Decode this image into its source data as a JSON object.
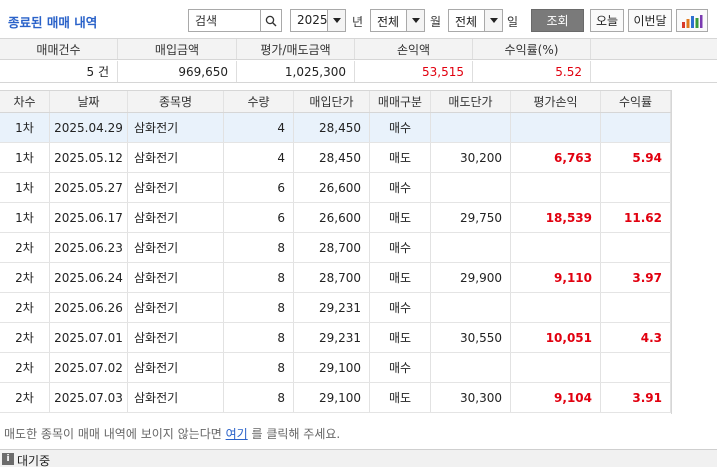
{
  "header": {
    "title": "종료된 매매 내역",
    "search": {
      "value": "검색",
      "placeholder": "검색"
    },
    "year": "2025",
    "year_suffix": "년",
    "month": "전체",
    "month_suffix": "월",
    "day": "전체",
    "day_suffix": "일",
    "query_button": "조회",
    "today_button": "오늘",
    "this_month_button": "이번달",
    "chart_icon": "bar-chart-icon"
  },
  "summary": {
    "columns": [
      "매매건수",
      "매입금액",
      "평가/매도금액",
      "손익액",
      "수익률(%)"
    ],
    "values": {
      "count": "5 건",
      "buy_amount": "969,650",
      "sell_amount": "1,025,300",
      "profit": "53,515",
      "rate": "5.52"
    }
  },
  "grid": {
    "columns": [
      "차수",
      "날짜",
      "종목명",
      "수량",
      "매입단가",
      "매매구분",
      "매도단가",
      "평가손익",
      "수익률"
    ],
    "rows": [
      {
        "round": "1차",
        "date": "2025.04.29",
        "name": "삼화전기",
        "qty": "4",
        "buy_price": "28,450",
        "type": "매수",
        "sell_price": "",
        "profit": "",
        "rate": ""
      },
      {
        "round": "1차",
        "date": "2025.05.12",
        "name": "삼화전기",
        "qty": "4",
        "buy_price": "28,450",
        "type": "매도",
        "sell_price": "30,200",
        "profit": "6,763",
        "rate": "5.94"
      },
      {
        "round": "1차",
        "date": "2025.05.27",
        "name": "삼화전기",
        "qty": "6",
        "buy_price": "26,600",
        "type": "매수",
        "sell_price": "",
        "profit": "",
        "rate": ""
      },
      {
        "round": "1차",
        "date": "2025.06.17",
        "name": "삼화전기",
        "qty": "6",
        "buy_price": "26,600",
        "type": "매도",
        "sell_price": "29,750",
        "profit": "18,539",
        "rate": "11.62"
      },
      {
        "round": "2차",
        "date": "2025.06.23",
        "name": "삼화전기",
        "qty": "8",
        "buy_price": "28,700",
        "type": "매수",
        "sell_price": "",
        "profit": "",
        "rate": ""
      },
      {
        "round": "2차",
        "date": "2025.06.24",
        "name": "삼화전기",
        "qty": "8",
        "buy_price": "28,700",
        "type": "매도",
        "sell_price": "29,900",
        "profit": "9,110",
        "rate": "3.97"
      },
      {
        "round": "2차",
        "date": "2025.06.26",
        "name": "삼화전기",
        "qty": "8",
        "buy_price": "29,231",
        "type": "매수",
        "sell_price": "",
        "profit": "",
        "rate": ""
      },
      {
        "round": "2차",
        "date": "2025.07.01",
        "name": "삼화전기",
        "qty": "8",
        "buy_price": "29,231",
        "type": "매도",
        "sell_price": "30,550",
        "profit": "10,051",
        "rate": "4.3"
      },
      {
        "round": "2차",
        "date": "2025.07.02",
        "name": "삼화전기",
        "qty": "8",
        "buy_price": "29,100",
        "type": "매수",
        "sell_price": "",
        "profit": "",
        "rate": ""
      },
      {
        "round": "2차",
        "date": "2025.07.03",
        "name": "삼화전기",
        "qty": "8",
        "buy_price": "29,100",
        "type": "매도",
        "sell_price": "30,300",
        "profit": "9,104",
        "rate": "3.91"
      }
    ]
  },
  "footer": {
    "note_before": "매도한 종목이 매매 내역에 보이지 않는다면 ",
    "note_link": "여기",
    "note_after": " 를 클릭해 주세요.",
    "status": "대기중",
    "status_icon": "info-icon"
  },
  "colors": {
    "accent": "#2a62c9",
    "profit_red": "#e1000f",
    "selected_row": "#e9f2fb",
    "query_button_bg": "#7a7a7a"
  }
}
